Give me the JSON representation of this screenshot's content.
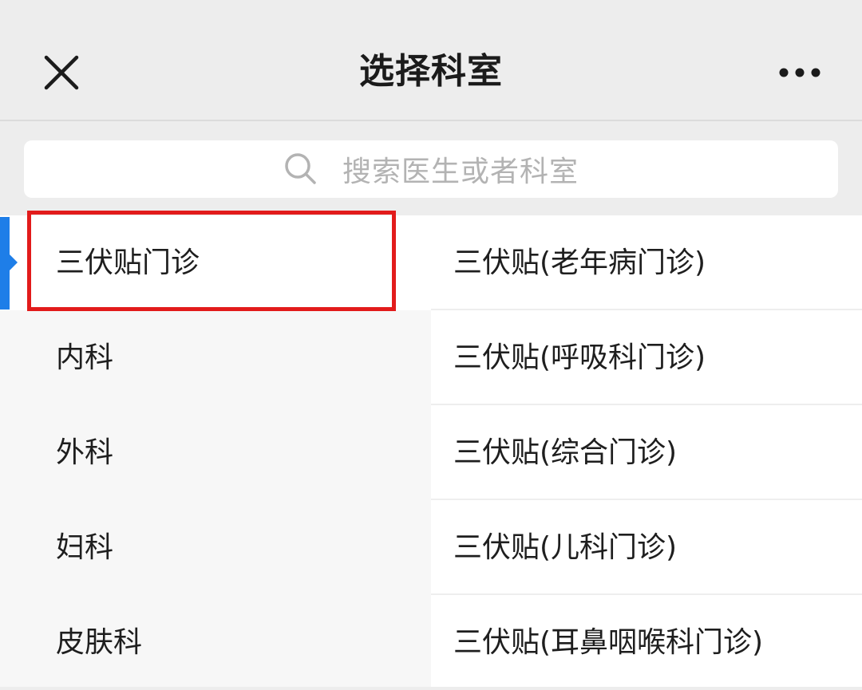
{
  "header": {
    "title": "选择科室",
    "close_icon": "close-icon",
    "more_icon": "more-horizontal-icon"
  },
  "search": {
    "placeholder": "搜索医生或者科室",
    "icon": "search-icon"
  },
  "departments": [
    {
      "label": "三伏贴门诊",
      "selected": true
    },
    {
      "label": "内科",
      "selected": false
    },
    {
      "label": "外科",
      "selected": false
    },
    {
      "label": "妇科",
      "selected": false
    },
    {
      "label": "皮肤科",
      "selected": false
    }
  ],
  "sub_departments": [
    {
      "label": "三伏贴(老年病门诊)"
    },
    {
      "label": "三伏贴(呼吸科门诊)"
    },
    {
      "label": "三伏贴(综合门诊)"
    },
    {
      "label": "三伏贴(儿科门诊)"
    },
    {
      "label": "三伏贴(耳鼻咽喉科门诊)"
    }
  ],
  "colors": {
    "accent": "#1e7ee8",
    "highlight": "#e21b1b"
  }
}
